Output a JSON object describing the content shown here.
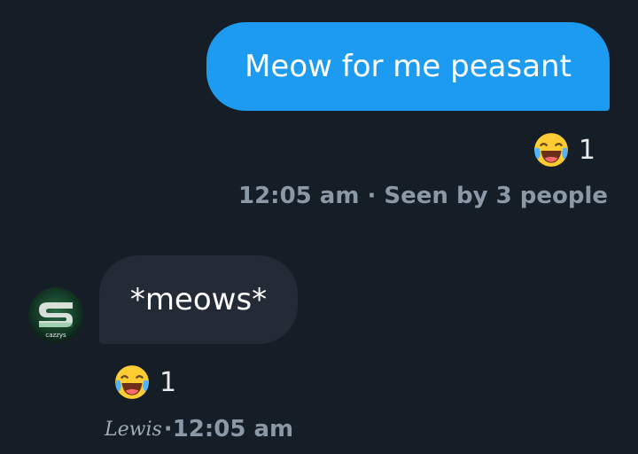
{
  "messages": {
    "outgoing": {
      "text": "Meow for me peasant",
      "reaction_count": "1",
      "time": "12:05 am",
      "separator": " · ",
      "seen": "Seen by 3 people",
      "bubble_color": "#1d9bf0",
      "reaction_icon": "face-with-tears-of-joy-icon"
    },
    "incoming": {
      "text": "*meows*",
      "reaction_count": "1",
      "sender": "Lewis",
      "separator": "· ",
      "time": "12:05 am",
      "avatar_text": "cazzys",
      "bubble_color": "#232b36",
      "reaction_icon": "face-with-tears-of-joy-icon"
    }
  },
  "colors": {
    "background": "#151d27",
    "meta_text": "#8b98a5"
  }
}
